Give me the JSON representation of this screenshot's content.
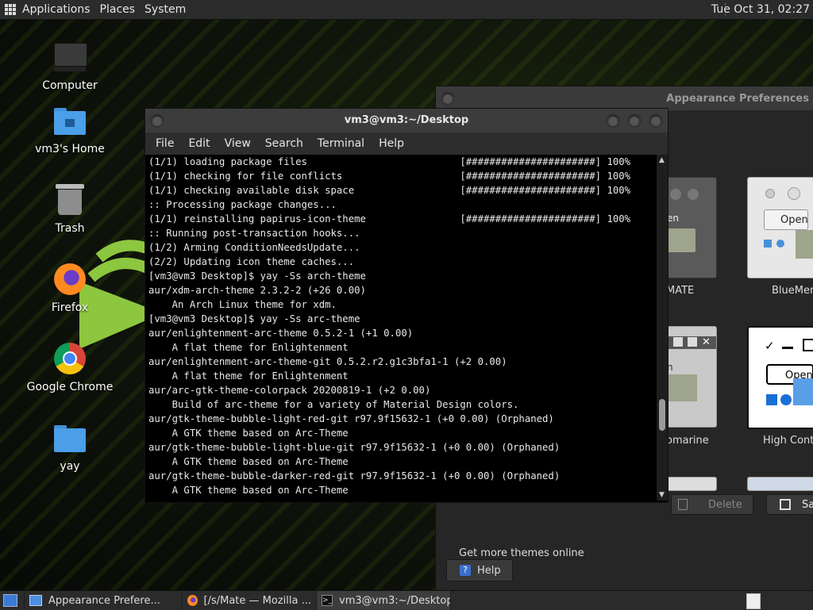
{
  "top_panel": {
    "menus": [
      "Applications",
      "Places",
      "System"
    ],
    "clock": "Tue Oct 31, 02:27"
  },
  "desktop_icons": [
    {
      "label": "Computer",
      "icon": "computer-icon"
    },
    {
      "label": "vm3's Home",
      "icon": "home-folder-icon"
    },
    {
      "label": "Trash",
      "icon": "trash-icon"
    },
    {
      "label": "Firefox",
      "icon": "firefox-icon"
    },
    {
      "label": "Google Chrome",
      "icon": "chrome-icon"
    },
    {
      "label": "yay",
      "icon": "folder-icon"
    }
  ],
  "appearance_window": {
    "title": "Appearance Preferences",
    "themes": [
      "MATE",
      "BlueMen",
      "omarine",
      "High Contr"
    ],
    "tile_text": [
      "en",
      "Open",
      "n",
      "Open"
    ],
    "delete_label": "Delete",
    "save_label": "Sav",
    "get_more": "Get more themes online",
    "help_label": "Help"
  },
  "terminal": {
    "title": "vm3@vm3:~/Desktop",
    "menus": [
      "File",
      "Edit",
      "View",
      "Search",
      "Terminal",
      "Help"
    ],
    "lines": [
      "(1/1) loading package files                          [######################] 100%",
      "(1/1) checking for file conflicts                    [######################] 100%",
      "(1/1) checking available disk space                  [######################] 100%",
      ":: Processing package changes...",
      "(1/1) reinstalling papirus-icon-theme                [######################] 100%",
      ":: Running post-transaction hooks...",
      "(1/2) Arming ConditionNeedsUpdate...",
      "(2/2) Updating icon theme caches...",
      "[vm3@vm3 Desktop]$ yay -Ss arch-theme",
      "aur/xdm-arch-theme 2.3.2-2 (+26 0.00)",
      "    An Arch Linux theme for xdm.",
      "[vm3@vm3 Desktop]$ yay -Ss arc-theme",
      "aur/enlightenment-arc-theme 0.5.2-1 (+1 0.00)",
      "    A flat theme for Enlightenment",
      "aur/enlightenment-arc-theme-git 0.5.2.r2.g1c3bfa1-1 (+2 0.00)",
      "    A flat theme for Enlightenment",
      "aur/arc-gtk-theme-colorpack 20200819-1 (+2 0.00)",
      "    Build of arc-theme for a variety of Material Design colors.",
      "aur/gtk-theme-bubble-light-red-git r97.9f15632-1 (+0 0.00) (Orphaned)",
      "    A GTK theme based on Arc-Theme",
      "aur/gtk-theme-bubble-light-blue-git r97.9f15632-1 (+0 0.00) (Orphaned)",
      "    A GTK theme based on Arc-Theme",
      "aur/gtk-theme-bubble-darker-red-git r97.9f15632-1 (+0 0.00) (Orphaned)",
      "    A GTK theme based on Arc-Theme"
    ]
  },
  "taskbar": {
    "items": [
      {
        "label": "Appearance Prefere...",
        "icon": "appearance-icon"
      },
      {
        "label": "[/s/Mate — Mozilla ...",
        "icon": "firefox-icon"
      },
      {
        "label": "vm3@vm3:~/Desktop",
        "icon": "terminal-icon"
      }
    ]
  },
  "colors": {
    "panel": "#2b2b2b",
    "terminal_bg": "#000000",
    "accent_green": "#8dc63f"
  }
}
